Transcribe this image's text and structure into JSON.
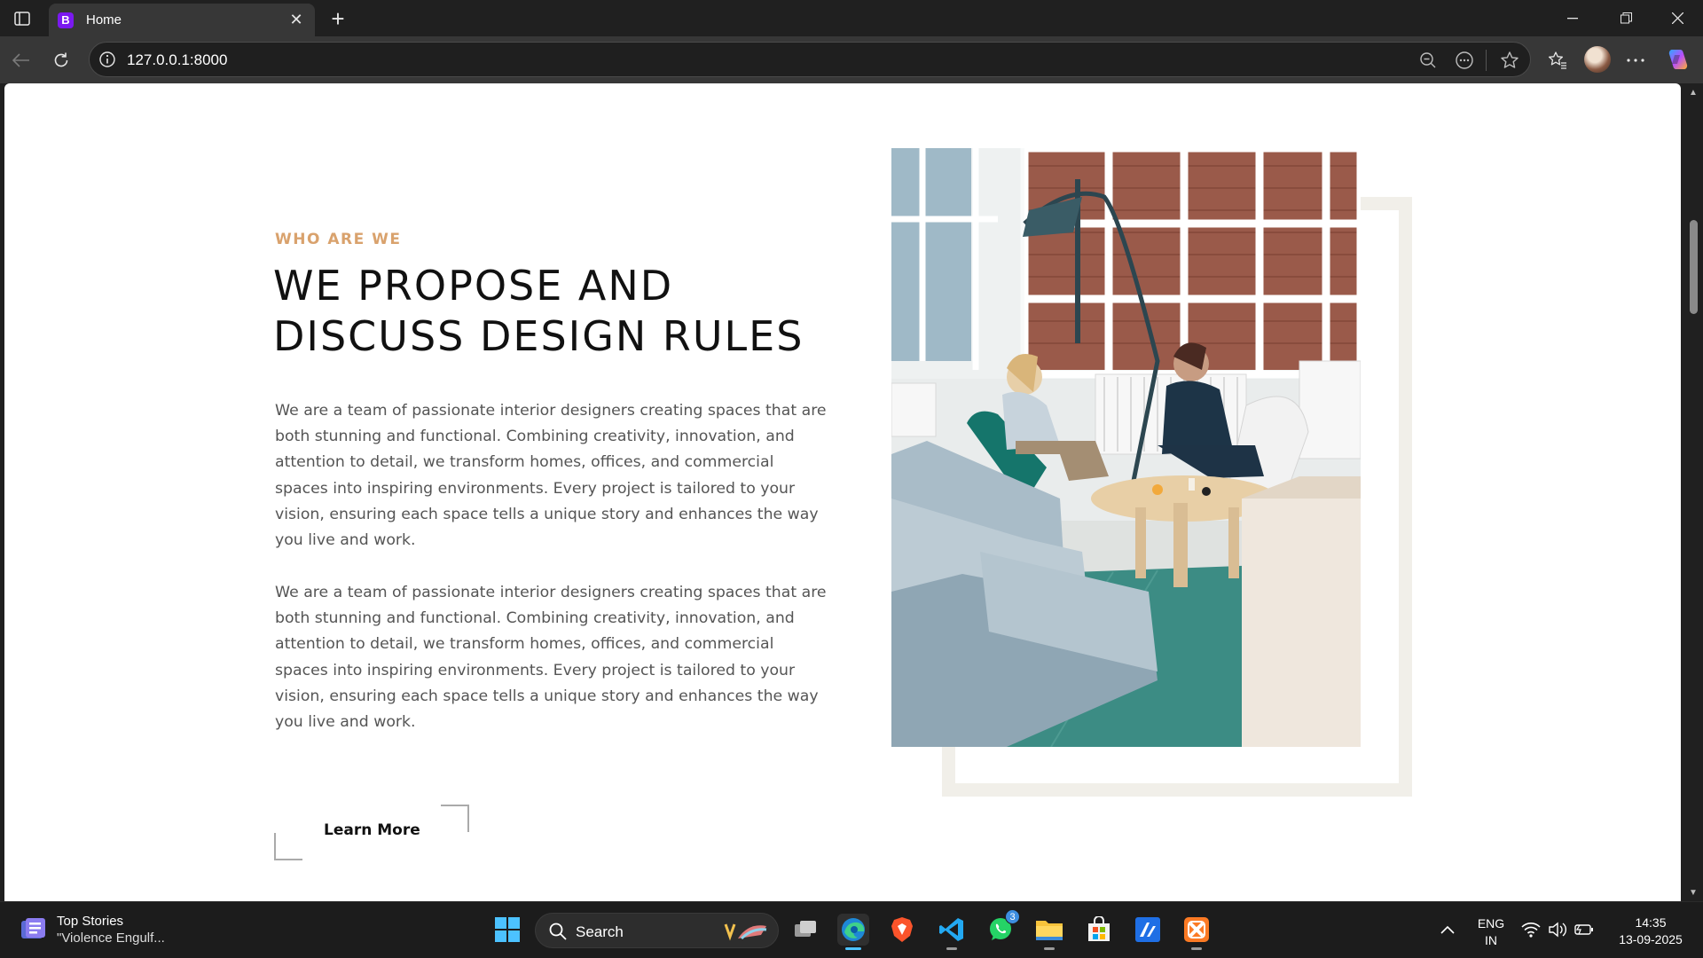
{
  "browser": {
    "tab_title": "Home",
    "tab_favicon_letter": "B",
    "url": "127.0.0.1:8000"
  },
  "page": {
    "eyebrow": "WHO ARE WE",
    "headline_line1": "WE PROPOSE AND",
    "headline_line2": "DISCUSS DESIGN RULES",
    "paragraph1": "We are a team of passionate interior designers creating spaces that are both stunning and functional. Combining creativity, innovation, and attention to detail, we transform homes, offices, and commercial spaces into inspiring environments. Every project is tailored to your vision, ensuring each space tells a unique story and enhances the way you live and work.",
    "paragraph2": "We are a team of passionate interior designers creating spaces that are both stunning and functional. Combining creativity, innovation, and attention to detail, we transform homes, offices, and commercial spaces into inspiring environments. Every project is tailored to your vision, ensuring each space tells a unique story and enhances the way you live and work.",
    "cta_label": "Learn More",
    "accent_color": "#d9a26d"
  },
  "taskbar": {
    "news_title": "Top Stories",
    "news_subtitle": "\"Violence Engulf...",
    "search_label": "Search",
    "whatsapp_badge": "3",
    "lang_line1": "ENG",
    "lang_line2": "IN",
    "time": "14:35",
    "date": "13-09-2025"
  }
}
